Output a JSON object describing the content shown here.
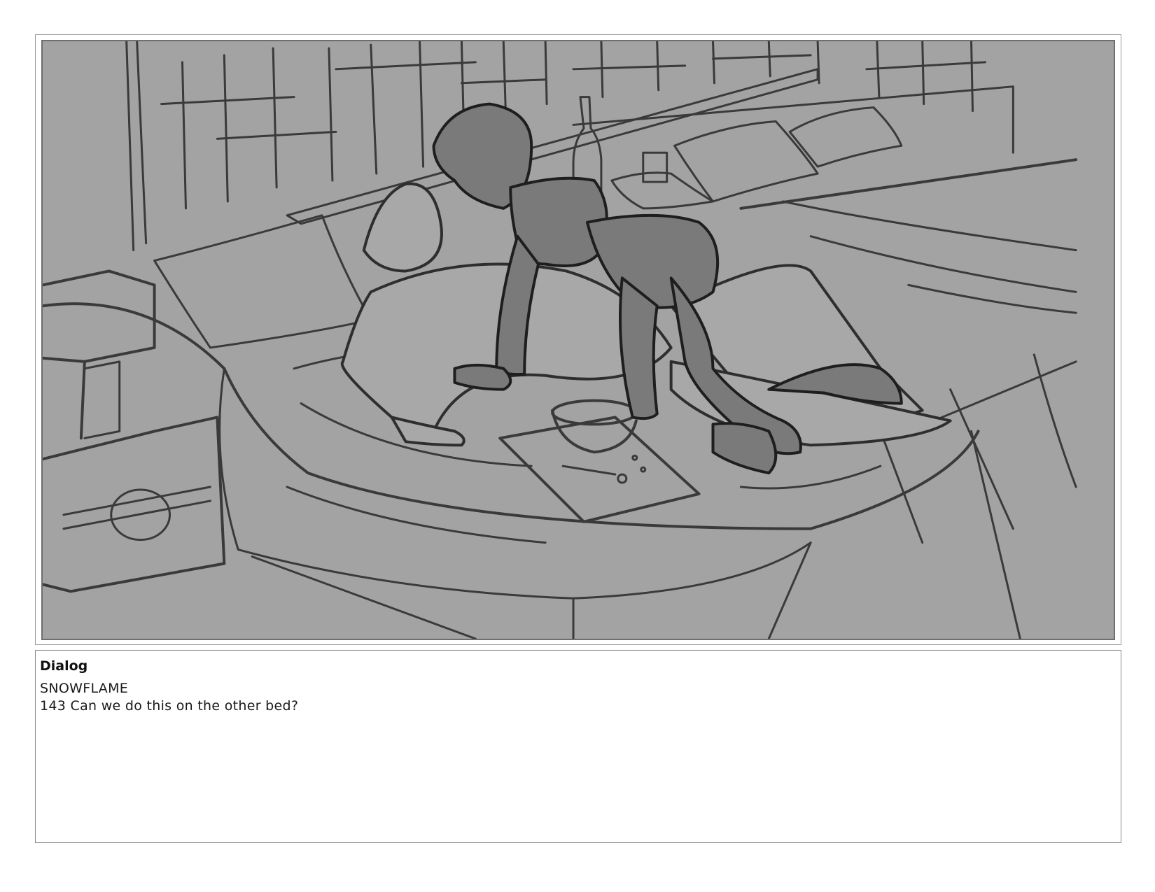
{
  "panel": {
    "background_color": "#a3a3a3",
    "line_color": "#3a3a3a",
    "figure_fill": "#7a7a7a"
  },
  "dialog": {
    "heading": "Dialog",
    "character": "SNOWFLAME",
    "line": "143 Can we do this on the other bed?"
  }
}
